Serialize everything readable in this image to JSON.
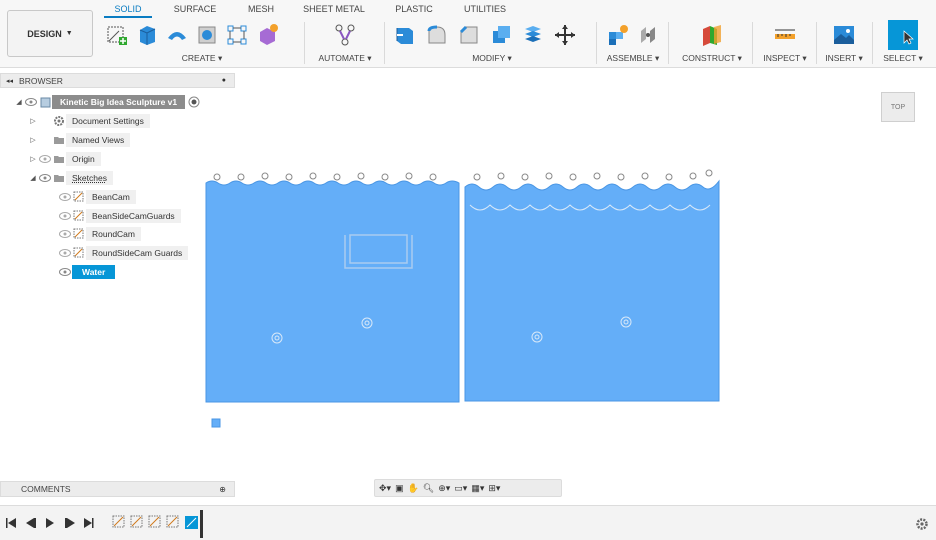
{
  "toolbar": {
    "design_label": "DESIGN",
    "tabs": [
      "SOLID",
      "SURFACE",
      "MESH",
      "SHEET METAL",
      "PLASTIC",
      "UTILITIES"
    ],
    "groups": {
      "create": "CREATE",
      "automate": "AUTOMATE",
      "modify": "MODIFY",
      "assemble": "ASSEMBLE",
      "construct": "CONSTRUCT",
      "inspect": "INSPECT",
      "insert": "INSERT",
      "select": "SELECT"
    }
  },
  "browser": {
    "title": "BROWSER",
    "root": "Kinetic Big Idea Sculpture v1",
    "items": [
      "Document Settings",
      "Named Views",
      "Origin",
      "Sketches"
    ],
    "sketches": [
      "BeanCam",
      "BeanSideCamGuards",
      "RoundCam",
      "RoundSideCam Guards",
      "Water"
    ]
  },
  "comments": {
    "title": "COMMENTS"
  },
  "viewcube": {
    "label": "TOP"
  },
  "colors": {
    "accent": "#0696d7",
    "sketch_fill": "#64aef8"
  }
}
